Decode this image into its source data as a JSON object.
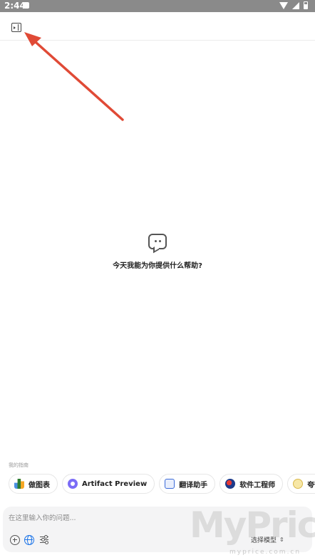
{
  "status_bar": {
    "time": "2:44"
  },
  "welcome": {
    "message": "今天我能为你提供什么帮助?"
  },
  "shortcuts": {
    "label": "我的指南",
    "items": [
      {
        "label": "做图表",
        "icon": "bar-chart-icon"
      },
      {
        "label": "Artifact Preview",
        "icon": "artifact-icon"
      },
      {
        "label": "翻译助手",
        "icon": "translate-icon"
      },
      {
        "label": "软件工程师",
        "icon": "engineer-icon"
      },
      {
        "label": "夸夸机",
        "icon": "praise-icon"
      }
    ]
  },
  "composer": {
    "placeholder": "在这里输入你的问题...",
    "model_label": "选择模型"
  },
  "watermark": {
    "main": "MyPrice",
    "sub": "myprice.com.cn"
  },
  "colors": {
    "arrow": "#e04a36",
    "status_bar": "#8a8a8a",
    "globe": "#1a73e8"
  }
}
